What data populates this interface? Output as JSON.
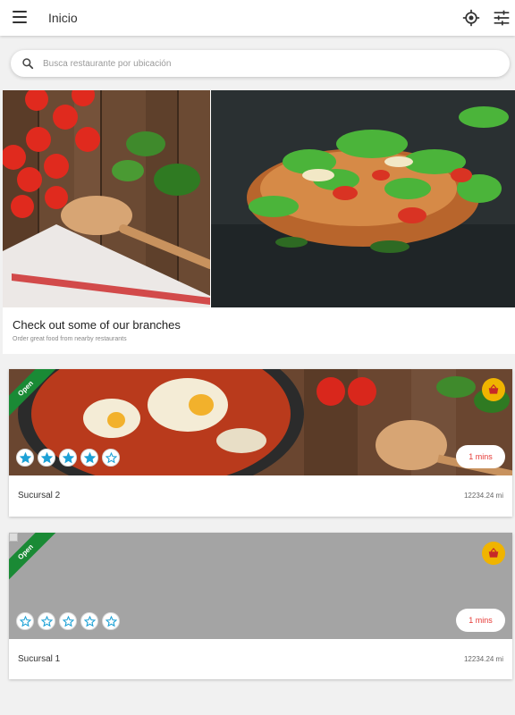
{
  "appbar": {
    "title": "Inicio",
    "menu_icon": "menu-icon",
    "locate_icon": "my-location-icon",
    "filter_icon": "tune-icon"
  },
  "search": {
    "placeholder": "Busca restaurante por ubicación",
    "icon": "search-icon"
  },
  "carousel": {
    "slide_count": 3,
    "active_index": 2
  },
  "intro": {
    "title": "Check out some of our branches",
    "subtitle": "Order great food from nearby restaurants"
  },
  "restaurants": [
    {
      "status": "Open",
      "name": "Sucursal 2",
      "distance": "12234.24 mi",
      "time": "1 mins",
      "rating": 4,
      "max_rating": 5
    },
    {
      "status": "Open",
      "name": "Sucursal 1",
      "distance": "12234.24 mi",
      "time": "1 mins",
      "rating": 0,
      "max_rating": 5
    }
  ],
  "colors": {
    "open_badge": "#1a8a35",
    "basket": "#f0b400",
    "star": "#1da1d6",
    "time_text": "#e53935"
  }
}
